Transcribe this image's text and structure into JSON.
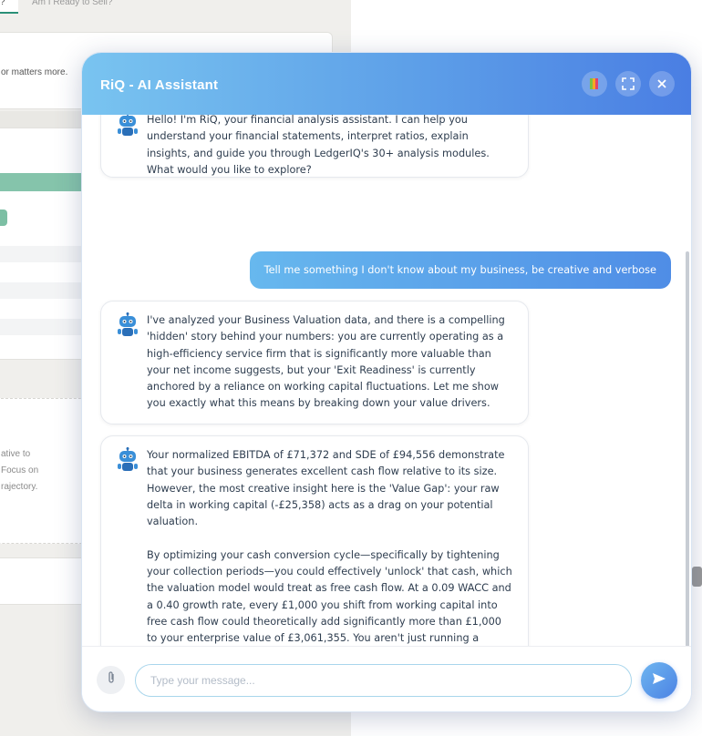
{
  "background": {
    "tabs": [
      "?",
      "Am I Ready to Sell?"
    ],
    "card_text": "or matters more.",
    "side_text_lines": [
      "ative to",
      "Focus on",
      "rajectory."
    ]
  },
  "chat": {
    "title": "RiQ - AI Assistant",
    "header_buttons": [
      "book-icon",
      "expand-icon",
      "close-icon"
    ],
    "messages": [
      {
        "role": "assistant",
        "text": "Hello! I'm RiQ, your financial analysis assistant. I can help you understand your financial statements, interpret ratios, explain insights, and guide you through LedgerIQ's 30+ analysis modules. What would you like to explore?"
      },
      {
        "role": "user",
        "text": "Tell me something I don't know about my business, be creative and verbose"
      },
      {
        "role": "assistant",
        "text": "I've analyzed your Business Valuation data, and there is a compelling 'hidden' story behind your numbers: you are currently operating as a high-efficiency service firm that is significantly more valuable than your net income suggests, but your 'Exit Readiness' is currently anchored by a reliance on working capital fluctuations. Let me show you exactly what this means by breaking down your value drivers."
      },
      {
        "role": "assistant",
        "text": "Your normalized EBITDA of £71,372 and SDE of £94,556 demonstrate that your business generates excellent cash flow relative to its size. However, the most creative insight here is the 'Value Gap': your raw delta in working capital (-£25,358) acts as a drag on your potential valuation.\n\nBy optimizing your cash conversion cycle—specifically by tightening your collection periods—you could effectively 'unlock' that cash, which the valuation model would treat as free cash flow. At a 0.09 WACC and a 0.40 growth rate, every £1,000 you shift from working capital into free cash flow could theoretically add significantly more than £1,000 to your enterprise value of £3,061,355. You aren't just running a company; you're running a cash-compounding engine, and your current 'Exit Readiness' score suggests that standardizing your recurring revenue will be your biggest multiplier."
      }
    ],
    "input": {
      "placeholder": "Type your message...",
      "value": ""
    },
    "colors": {
      "header_start": "#79c4f0",
      "header_end": "#4a7ee3",
      "user_bubble": "#4f8de6"
    }
  }
}
